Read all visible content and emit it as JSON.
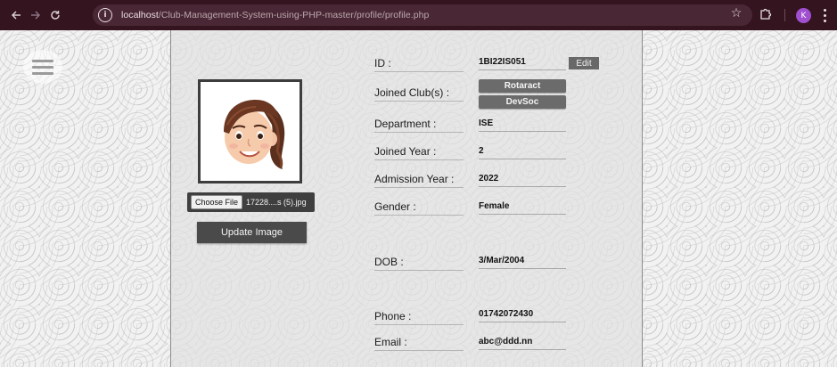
{
  "browser": {
    "url_host": "localhost",
    "url_path": "/Club-Management-System-using-PHP-master/profile/profile.php",
    "avatar_letter": "K",
    "avatar_color": "#a04fd0"
  },
  "colors": {
    "chrome_bg": "#33141f",
    "button_dark": "#4a4a4a",
    "club_button": "#6b6b6b"
  },
  "icons": {
    "back": "arrow-left",
    "forward": "arrow-right",
    "reload": "reload",
    "site_info": "info-circle",
    "bookmark": "star",
    "extensions": "puzzle",
    "menu": "kebab",
    "hamburger": "hamburger-menu"
  },
  "photo": {
    "file_button_label": "Choose File",
    "file_name": "17228....s (5).jpg",
    "update_label": "Update Image"
  },
  "profile": {
    "id_label": "ID :",
    "id_value": "1BI22IS051",
    "edit_label": "Edit",
    "clubs_label": "Joined Club(s) :",
    "clubs": [
      "Rotaract",
      "DevSoc"
    ],
    "department_label": "Department :",
    "department_value": "ISE",
    "joined_year_label": "Joined Year :",
    "joined_year_value": "2",
    "admission_year_label": "Admission Year :",
    "admission_year_value": "2022",
    "gender_label": "Gender :",
    "gender_value": "Female",
    "dob_label": "DOB :",
    "dob_value": "3/Mar/2004",
    "phone_label": "Phone :",
    "phone_value": "01742072430",
    "email_label": "Email :",
    "email_value": "abc@ddd.nn"
  }
}
